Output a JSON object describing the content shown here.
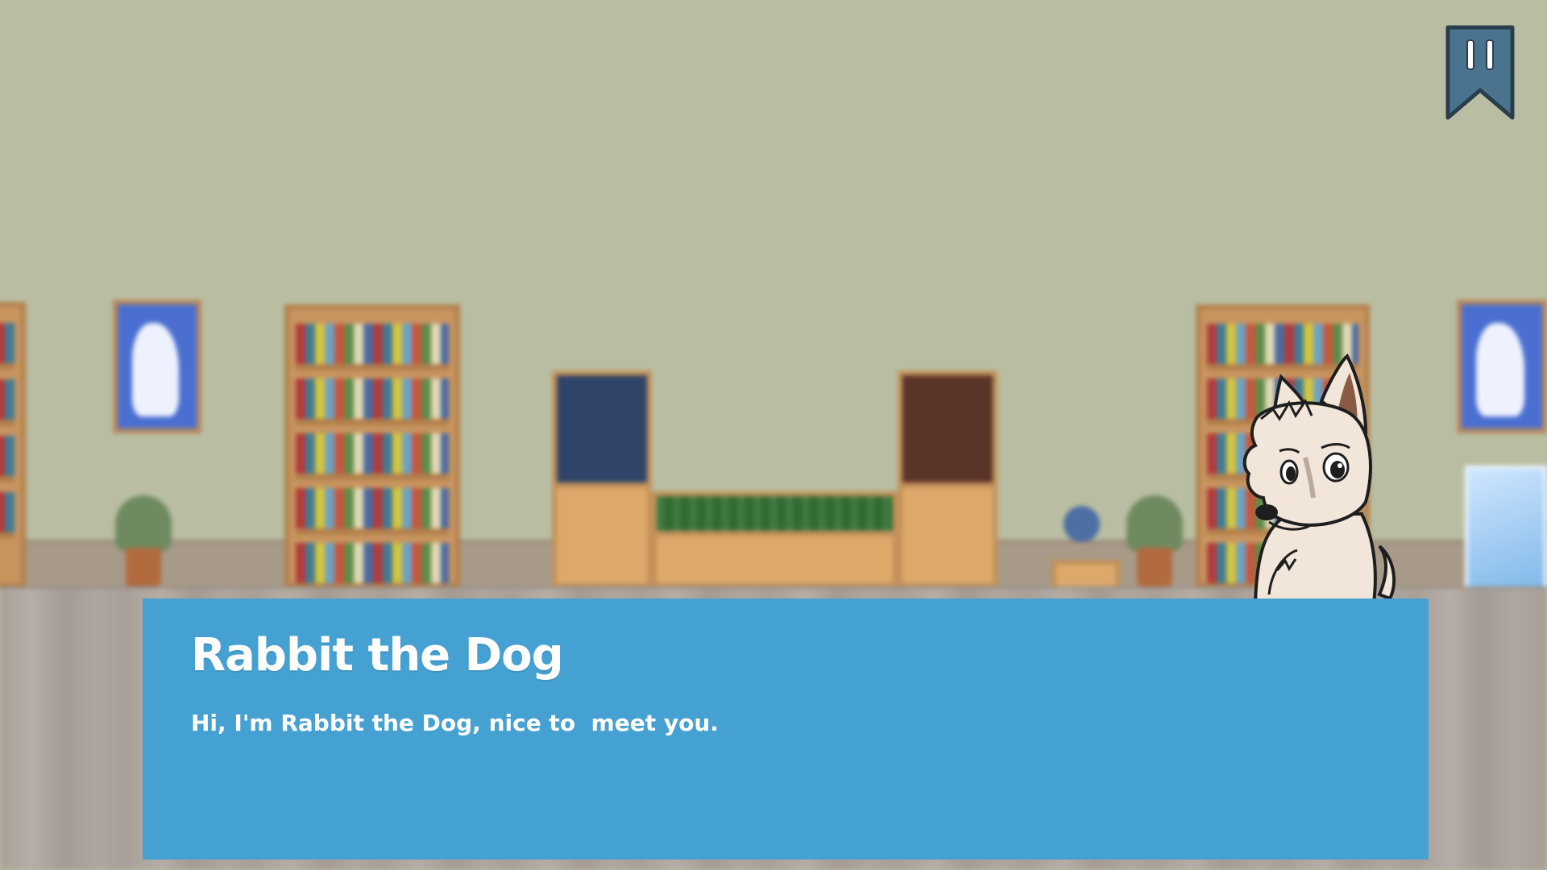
{
  "scene": {
    "background_name": "library-room",
    "wall_color": "#b9bea2",
    "floor_color": "#aba39c"
  },
  "hud": {
    "pause_icon": "pause-bookmark-icon",
    "pause_color": "#4a7390"
  },
  "character": {
    "name": "Rabbit the Dog",
    "sprite": "dog-character-sprite"
  },
  "dialog": {
    "speaker": "Rabbit the Dog",
    "text": "Hi, I'm Rabbit the Dog, nice to  meet you.",
    "box_color": "#45a1d2"
  }
}
